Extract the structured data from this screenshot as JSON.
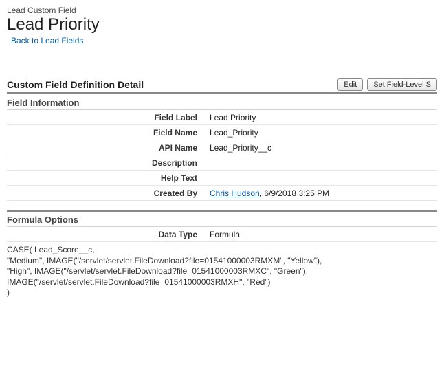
{
  "page": {
    "breadcrumb": "Lead Custom Field",
    "title": "Lead Priority",
    "back_link": "Back to Lead Fields"
  },
  "detail": {
    "header": "Custom Field Definition Detail",
    "buttons": {
      "edit": "Edit",
      "set_fls": "Set Field-Level S"
    }
  },
  "field_info": {
    "section_title": "Field Information",
    "labels": {
      "field_label": "Field Label",
      "field_name": "Field Name",
      "api_name": "API Name",
      "description": "Description",
      "help_text": "Help Text",
      "created_by": "Created By"
    },
    "values": {
      "field_label": "Lead Priority",
      "field_name": "Lead_Priority",
      "api_name": "Lead_Priority__c",
      "description": "",
      "help_text": "",
      "created_by_user": "Chris Hudson",
      "created_by_date": ", 6/9/2018 3:25 PM"
    }
  },
  "formula": {
    "section_title": "Formula Options",
    "labels": {
      "data_type": "Data Type"
    },
    "values": {
      "data_type": "Formula"
    },
    "formula_text": "CASE( Lead_Score__c,\n\"Medium\", IMAGE(\"/servlet/servlet.FileDownload?file=01541000003RMXM\", \"Yellow\"),\n\"High\", IMAGE(\"/servlet/servlet.FileDownload?file=01541000003RMXC\", \"Green\"),\nIMAGE(\"/servlet/servlet.FileDownload?file=01541000003RMXH\", \"Red\")\n)"
  }
}
